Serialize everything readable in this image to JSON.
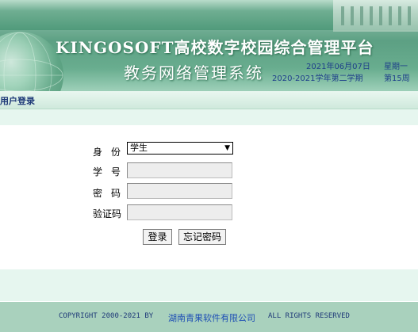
{
  "header": {
    "system_title": "KINGOSOFT高校数字校园综合管理平台",
    "subsystem_title": "教务网络管理系统",
    "date": "2021年06月07日",
    "weekday": "星期一",
    "term": "2020-2021学年第二学期",
    "week": "第15周"
  },
  "tab": {
    "label": "用户登录"
  },
  "form": {
    "role_label": "身份",
    "role_selected": "学生",
    "username_label": "学号",
    "username_value": "",
    "password_label": "密码",
    "password_value": "",
    "captcha_label": "验证码",
    "captcha_value": "",
    "login_button": "登录",
    "forgot_button": "忘记密码"
  },
  "footer": {
    "copyright": "COPYRIGHT 2000-2021 BY",
    "company": "湖南青果软件有限公司",
    "rights": "ALL RIGHTS RESERVED"
  },
  "colors": {
    "banner_green": "#3f8f6d",
    "panel_mint": "#e6f6ef",
    "footer_green": "#a9d1bd",
    "text_blue": "#1f3a78"
  }
}
